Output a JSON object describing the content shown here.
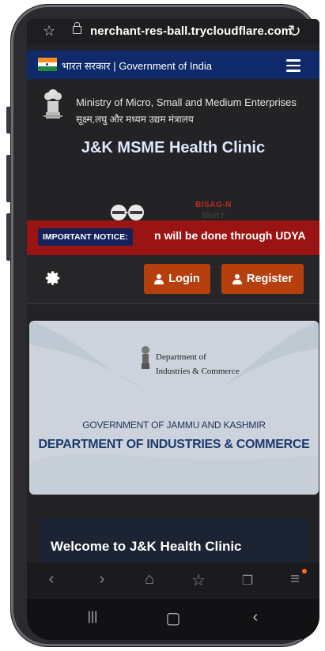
{
  "browser": {
    "url": "nerchant-res-ball.trycloudflare.com"
  },
  "gov_bar": {
    "text": "भारत सरकार | Government of India"
  },
  "ministry": {
    "name_en": "Ministry of Micro, Small and Medium Enterprises",
    "name_hi": "सूक्ष्म,लघु और मध्यम उद्यम मंत्रालय"
  },
  "site": {
    "title": "J&K MSME Health Clinic"
  },
  "partner_logos": {
    "bisag": "BISAG-N",
    "meity": "MeitY"
  },
  "notice": {
    "label": "IMPORTANT NOTICE:",
    "scroll_text": "n will be done through UDYA"
  },
  "auth": {
    "login_label": "Login",
    "register_label": "Register"
  },
  "banner": {
    "dept_line1": "Department of",
    "dept_line2": "Industries & Commerce",
    "gov_line": "GOVERNMENT OF JAMMU AND KASHMIR",
    "dept_title": "DEPARTMENT OF INDUSTRIES & COMMERCE"
  },
  "welcome": {
    "heading": "Welcome to J&K Health Clinic"
  },
  "colors": {
    "gov_bar": "#0f2a6b",
    "notice_bar": "#9a1414",
    "button": "#b5400e",
    "page_bg": "#232326"
  }
}
